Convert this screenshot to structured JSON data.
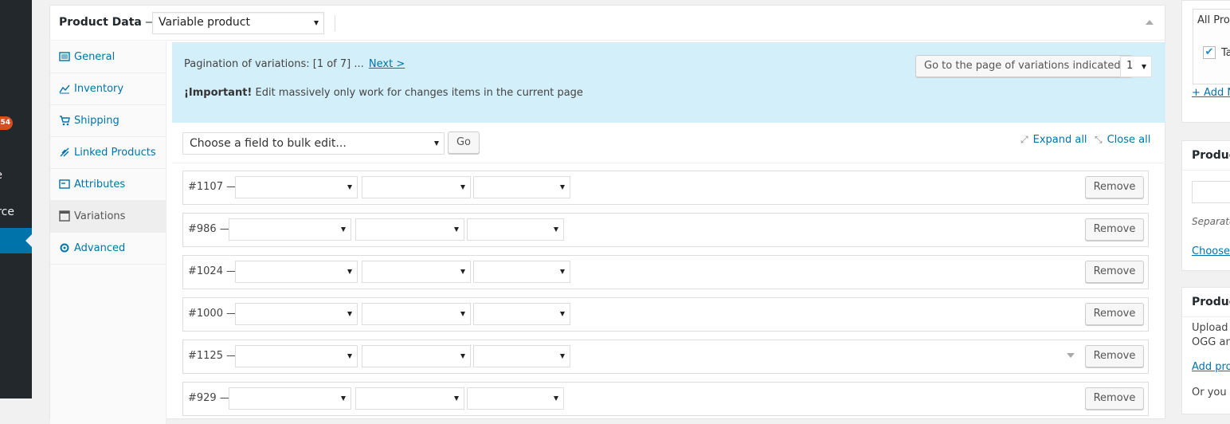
{
  "adminbar": {
    "badge": "54",
    "frag1": "e",
    "frag2": "rce"
  },
  "product_data": {
    "title": "Product Data",
    "dash": " —",
    "type_select": "Variable product"
  },
  "tabs": [
    {
      "label": "General",
      "icon": "general-icon"
    },
    {
      "label": "Inventory",
      "icon": "inventory-icon"
    },
    {
      "label": "Shipping",
      "icon": "shipping-icon"
    },
    {
      "label": "Linked Products",
      "icon": "linked-products-icon"
    },
    {
      "label": "Attributes",
      "icon": "attributes-icon"
    },
    {
      "label": "Variations",
      "icon": "variations-icon",
      "active": true
    },
    {
      "label": "Advanced",
      "icon": "advanced-icon"
    }
  ],
  "notice": {
    "pagination_text": "Pagination of variations: [1 of 7] ...",
    "next_link": "Next >",
    "important_label": "¡Important!",
    "important_text": " Edit massively only work for changes items in the current page",
    "goto_button": "Go to the page of variations indicated:",
    "page_value": "1",
    "bg_color": "#d3effa"
  },
  "toolbar": {
    "bulk_placeholder": "Choose a field to bulk edit...",
    "go_button": "Go",
    "expand_all": "Expand all",
    "close_all": "Close all"
  },
  "variations": [
    {
      "id": "#1107 —",
      "remove": "Remove"
    },
    {
      "id": "#986 —",
      "remove": "Remove"
    },
    {
      "id": "#1024 —",
      "remove": "Remove"
    },
    {
      "id": "#1000 —",
      "remove": "Remove"
    },
    {
      "id": "#1125 —",
      "remove": "Remove"
    },
    {
      "id": "#929 —",
      "remove": "Remove"
    }
  ],
  "sidebar": {
    "box1": {
      "tab_label": "All Prod",
      "checked_label": "Ta",
      "add_link": "+ Add N"
    },
    "box2": {
      "title": "Produc",
      "note": "Separate",
      "choose_link": "Choose"
    },
    "box3": {
      "title": "Produc",
      "line1": "Upload",
      "line2": "OGG an",
      "add_link": "Add pro",
      "line3": "Or you c"
    }
  }
}
